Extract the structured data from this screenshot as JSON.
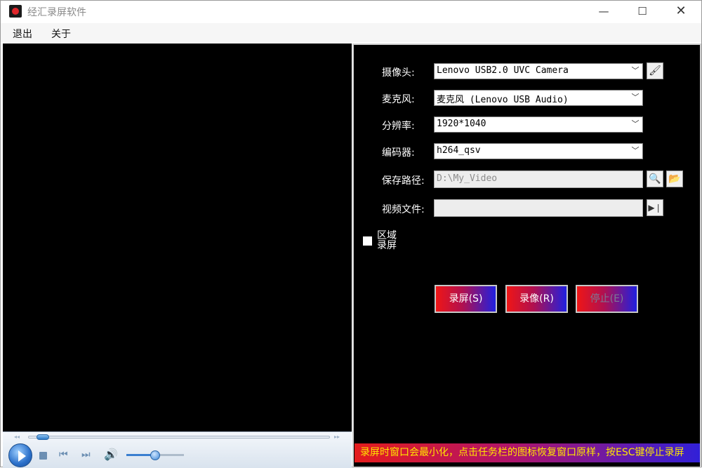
{
  "window": {
    "title": "经汇录屏软件",
    "minimize": "—",
    "maximize": "☐",
    "close": "✕"
  },
  "menu": {
    "exit": "退出",
    "about": "关于"
  },
  "player": {
    "seek_progress": 0.03,
    "volume_level": 0.5,
    "rewind": "◂◂",
    "forward": "▸▸"
  },
  "settings": {
    "camera": {
      "label": "摄像头:",
      "value": "Lenovo USB2.0 UVC Camera"
    },
    "microphone": {
      "label": "麦克风:",
      "value": "麦克风 (Lenovo USB Audio)"
    },
    "resolution": {
      "label": "分辨率:",
      "value": "1920*1040"
    },
    "encoder": {
      "label": "编码器:",
      "value": "h264_qsv"
    },
    "save_path": {
      "label": "保存路径:",
      "value": "D:\\My_Video"
    },
    "video_file": {
      "label": "视频文件:",
      "value": ""
    },
    "region": {
      "label": "区域录屏",
      "checked": false
    }
  },
  "actions": {
    "record_screen": "录屏(S)",
    "record_camera": "录像(R)",
    "stop": "停止(E)"
  },
  "status": {
    "text": "录屏时窗口会最小化，点击任务栏的图标恢复窗口原样，按ESC键停止录屏"
  },
  "colors": {
    "status_text": "#ffe600",
    "button_gradient_start": "#ef1616",
    "button_gradient_end": "#2020e0"
  }
}
